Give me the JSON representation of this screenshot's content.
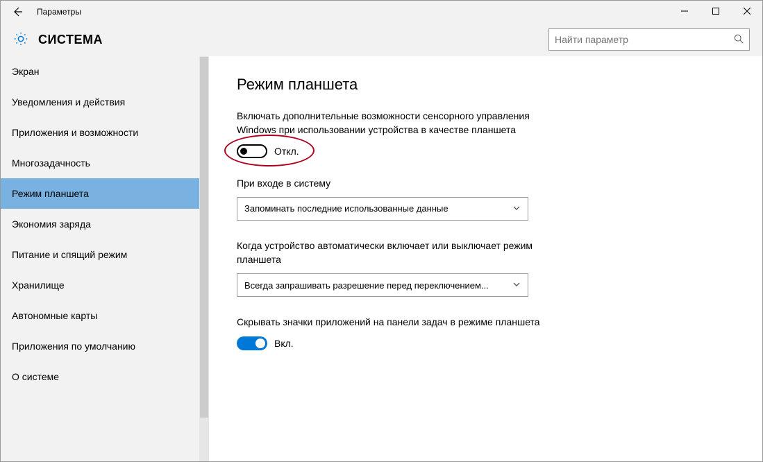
{
  "window": {
    "title": "Параметры"
  },
  "header": {
    "title": "СИСТЕМА",
    "search_placeholder": "Найти параметр"
  },
  "sidebar": {
    "items": [
      {
        "label": "Экран"
      },
      {
        "label": "Уведомления и действия"
      },
      {
        "label": "Приложения и возможности"
      },
      {
        "label": "Многозадачность"
      },
      {
        "label": "Режим планшета",
        "active": true
      },
      {
        "label": "Экономия заряда"
      },
      {
        "label": "Питание и спящий режим"
      },
      {
        "label": "Хранилище"
      },
      {
        "label": "Автономные карты"
      },
      {
        "label": "Приложения по умолчанию"
      },
      {
        "label": "О системе"
      }
    ]
  },
  "content": {
    "title": "Режим планшета",
    "setting1": {
      "label": "Включать дополнительные возможности сенсорного управления Windows при использовании устройства в качестве планшета",
      "state": "Откл."
    },
    "setting2": {
      "label": "При входе в систему",
      "value": "Запоминать последние использованные данные"
    },
    "setting3": {
      "label": "Когда устройство автоматически включает или выключает режим планшета",
      "value": "Всегда запрашивать разрешение перед переключением..."
    },
    "setting4": {
      "label": "Скрывать значки приложений на панели задач в режиме планшета",
      "state": "Вкл."
    }
  }
}
